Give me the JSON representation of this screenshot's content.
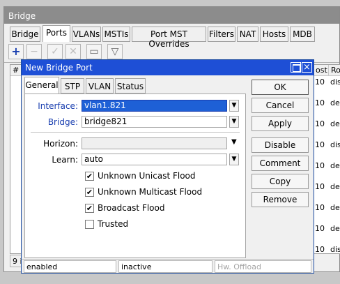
{
  "bridge_window": {
    "title": "Bridge",
    "tabs": [
      "Bridge",
      "Ports",
      "VLANs",
      "MSTIs",
      "Port MST Overrides",
      "Filters",
      "NAT",
      "Hosts",
      "MDB"
    ],
    "active_tab": "Ports",
    "toolbar": {
      "add": "+",
      "remove": "−",
      "enable": "✓",
      "disable": "✕",
      "comment": "▭",
      "filter": "▽"
    },
    "table": {
      "col_first": "#",
      "col_cost": "ost",
      "col_role": "Ro",
      "rows": [
        {
          "cost": "10",
          "role": "dis"
        },
        {
          "cost": "10",
          "role": "de"
        },
        {
          "cost": "10",
          "role": "de"
        },
        {
          "cost": "10",
          "role": "dis"
        },
        {
          "cost": "10",
          "role": "de"
        },
        {
          "cost": "10",
          "role": "de"
        },
        {
          "cost": "10",
          "role": "de"
        },
        {
          "cost": "10",
          "role": "de"
        },
        {
          "cost": "10",
          "role": "dis"
        },
        {
          "cost": "10",
          "role": "de"
        }
      ]
    },
    "status_count": "9 it"
  },
  "dialog": {
    "title": "New Bridge Port",
    "tabs": [
      "General",
      "STP",
      "VLAN",
      "Status"
    ],
    "active_tab": "General",
    "fields": {
      "interface_label": "Interface:",
      "interface_value": "vlan1.821",
      "bridge_label": "Bridge:",
      "bridge_value": "bridge821",
      "horizon_label": "Horizon:",
      "horizon_value": "",
      "learn_label": "Learn:",
      "learn_value": "auto"
    },
    "checkboxes": [
      {
        "label": "Unknown Unicast Flood",
        "checked": true
      },
      {
        "label": "Unknown Multicast Flood",
        "checked": true
      },
      {
        "label": "Broadcast Flood",
        "checked": true
      },
      {
        "label": "Trusted",
        "checked": false
      }
    ],
    "buttons": {
      "ok": "OK",
      "cancel": "Cancel",
      "apply": "Apply",
      "disable": "Disable",
      "comment": "Comment",
      "copy": "Copy",
      "remove": "Remove"
    },
    "status": {
      "state": "enabled",
      "running": "inactive",
      "hw_offload": "Hw. Offload"
    }
  }
}
